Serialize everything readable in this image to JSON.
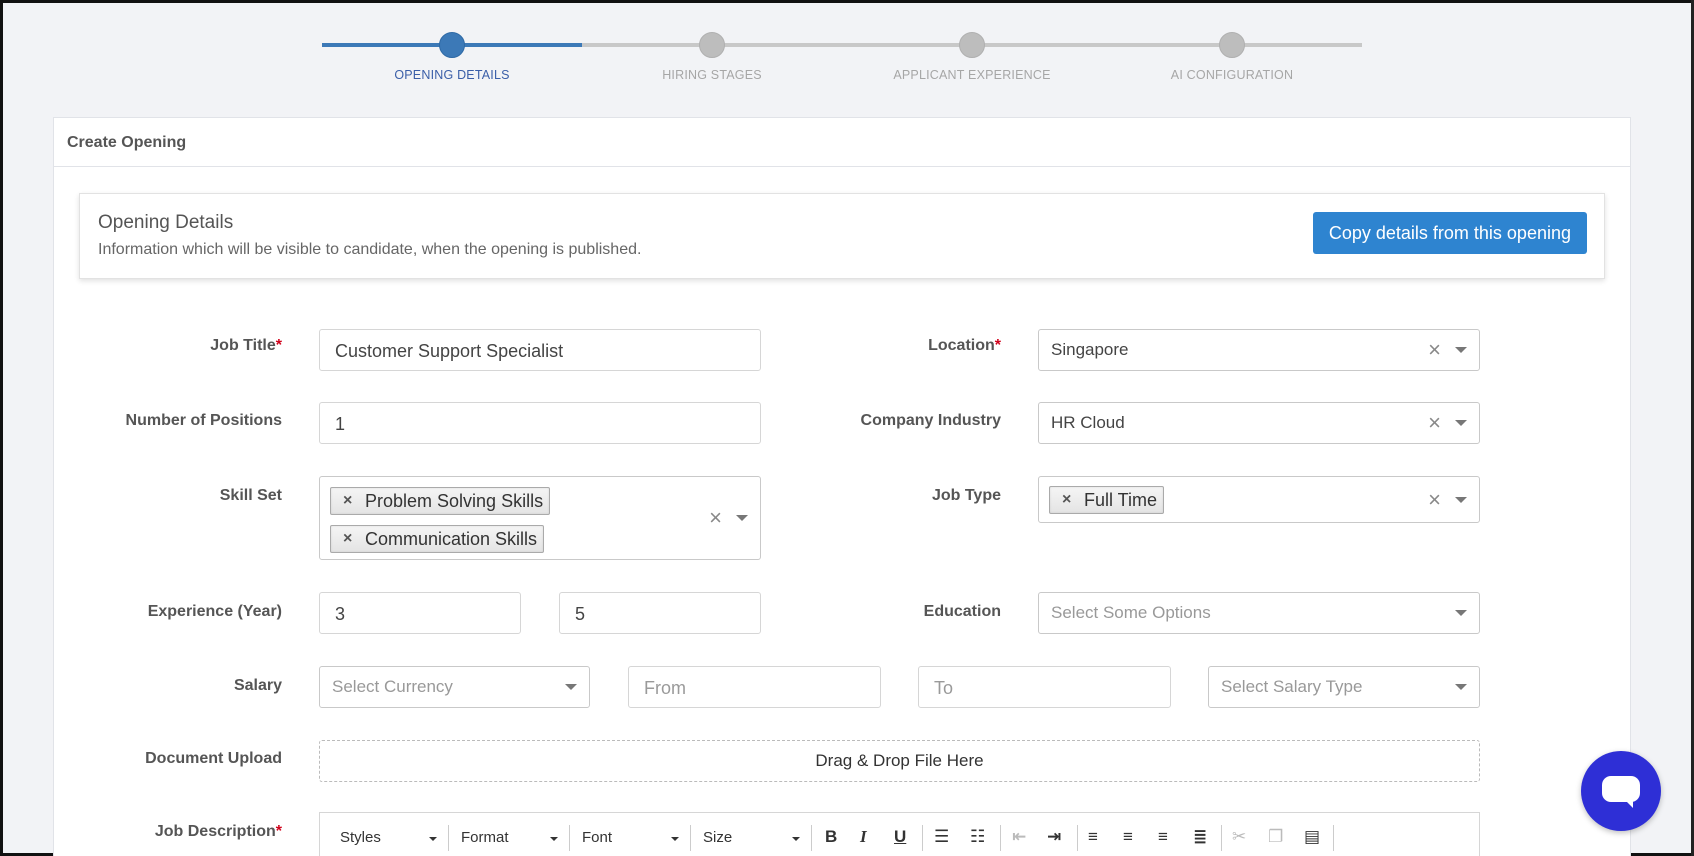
{
  "stepper": {
    "steps": [
      "OPENING DETAILS",
      "HIRING STAGES",
      "APPLICANT EXPERIENCE",
      "AI CONFIGURATION"
    ],
    "active_index": 0
  },
  "card": {
    "title": "Create Opening",
    "info_title": "Opening Details",
    "info_subtitle": "Information which will be visible to candidate, when the opening is published.",
    "copy_button": "Copy details from this opening"
  },
  "form": {
    "job_title": {
      "label": "Job Title",
      "required": "*",
      "value": "Customer Support Specialist"
    },
    "positions": {
      "label": "Number of Positions",
      "value": "1"
    },
    "skill_set": {
      "label": "Skill Set",
      "tags": [
        "Problem Solving Skills",
        "Communication Skills"
      ]
    },
    "experience": {
      "label": "Experience (Year)",
      "min": "3",
      "max": "5"
    },
    "salary": {
      "label": "Salary",
      "currency_placeholder": "Select Currency",
      "from_placeholder": "From",
      "to_placeholder": "To",
      "type_placeholder": "Select Salary Type"
    },
    "document_upload": {
      "label": "Document Upload",
      "dropzone": "Drag & Drop File Here"
    },
    "job_description": {
      "label": "Job Description",
      "required": "*",
      "toolbar": {
        "styles": "Styles",
        "format": "Format",
        "font": "Font",
        "size": "Size"
      }
    },
    "location": {
      "label": "Location",
      "required": "*",
      "value": "Singapore"
    },
    "industry": {
      "label": "Company Industry",
      "value": "HR Cloud"
    },
    "job_type": {
      "label": "Job Type",
      "tags": [
        "Full Time"
      ]
    },
    "education": {
      "label": "Education",
      "placeholder": "Select Some Options"
    }
  },
  "icons": {
    "remove": "×",
    "clear": "×"
  },
  "colors": {
    "accent": "#3c79b7",
    "button": "#2e84d0",
    "chat": "#2e2fd6",
    "required": "#d0021b"
  }
}
